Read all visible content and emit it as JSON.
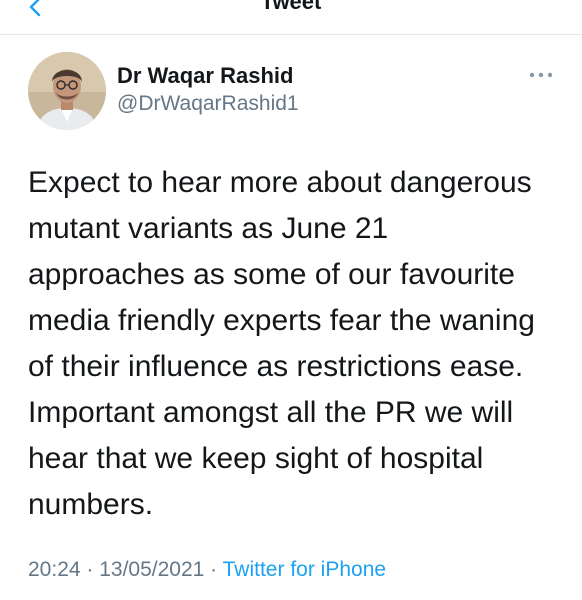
{
  "nav": {
    "title": "Tweet",
    "back_icon": "chevron-left-icon",
    "accent_color": "#1da1f2"
  },
  "author": {
    "display_name": "Dr Waqar Rashid",
    "handle": "@DrWaqarRashid1",
    "avatar": "profile-photo",
    "more_icon": "more-options-icon"
  },
  "tweet": {
    "lines": [
      "Expect to hear more about dangerous",
      "mutant variants as June 21",
      "approaches as some of our favourite",
      "media friendly experts fear the waning",
      "of their influence as restrictions ease.",
      "Important amongst all the PR we will",
      "hear that we keep sight of hospital",
      "numbers."
    ]
  },
  "meta": {
    "time": "20:24",
    "separator": " · ",
    "date": "13/05/2021",
    "source": "Twitter for iPhone"
  }
}
